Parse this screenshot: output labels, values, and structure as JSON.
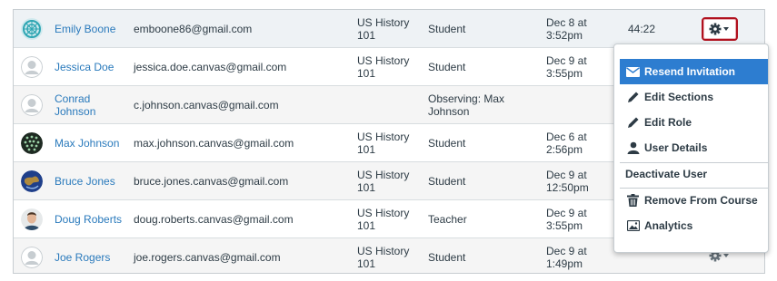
{
  "people": [
    {
      "name": "Emily Boone",
      "email": "emboone86@gmail.com",
      "section_line1": "US History",
      "section_line2": "101",
      "role_line1": "Student",
      "role_line2": "",
      "date_line1": "Dec 8 at",
      "date_line2": "3:52pm",
      "total_activity": "44:22",
      "avatar": "teal-pattern-avatar"
    },
    {
      "name": "Jessica Doe",
      "email": "jessica.doe.canvas@gmail.com",
      "section_line1": "US History",
      "section_line2": "101",
      "role_line1": "Student",
      "role_line2": "",
      "date_line1": "Dec 9 at",
      "date_line2": "3:55pm",
      "total_activity": "",
      "avatar": "default-avatar"
    },
    {
      "name_line1": "Conrad",
      "name_line2": "Johnson",
      "email": "c.johnson.canvas@gmail.com",
      "section_line1": "",
      "section_line2": "",
      "role_line1": "Observing: Max",
      "role_line2": "Johnson",
      "date_line1": "",
      "date_line2": "",
      "total_activity": "",
      "avatar": "default-avatar"
    },
    {
      "name": "Max Johnson",
      "email": "max.johnson.canvas@gmail.com",
      "section_line1": "US History",
      "section_line2": "101",
      "role_line1": "Student",
      "role_line2": "",
      "date_line1": "Dec 6 at",
      "date_line2": "2:56pm",
      "total_activity": "",
      "avatar": "dots-pattern-avatar"
    },
    {
      "name": "Bruce Jones",
      "email": "bruce.jones.canvas@gmail.com",
      "section_line1": "US History",
      "section_line2": "101",
      "role_line1": "Student",
      "role_line2": "",
      "date_line1": "Dec 9 at",
      "date_line2": "12:50pm",
      "total_activity": "",
      "avatar": "earth-avatar"
    },
    {
      "name": "Doug Roberts",
      "email": "doug.roberts.canvas@gmail.com",
      "section_line1": "US History",
      "section_line2": "101",
      "role_line1": "Teacher",
      "role_line2": "",
      "date_line1": "Dec 9 at",
      "date_line2": "3:55pm",
      "total_activity": "",
      "avatar": "photo-avatar"
    },
    {
      "name": "Joe Rogers",
      "email": "joe.rogers.canvas@gmail.com",
      "section_line1": "US History",
      "section_line2": "101",
      "role_line1": "Student",
      "role_line2": "",
      "date_line1": "Dec 9 at",
      "date_line2": "1:49pm",
      "total_activity": "",
      "avatar": "default-avatar"
    }
  ],
  "menu": {
    "resend_invitation": "Resend Invitation",
    "edit_sections": "Edit Sections",
    "edit_role": "Edit Role",
    "user_details": "User Details",
    "deactivate_user": "Deactivate User",
    "remove_from_course": "Remove From Course",
    "analytics": "Analytics"
  },
  "colors": {
    "link": "#2a7abc",
    "menu_selected": "#2d7dd0",
    "gear_active_border": "#b0101d"
  }
}
